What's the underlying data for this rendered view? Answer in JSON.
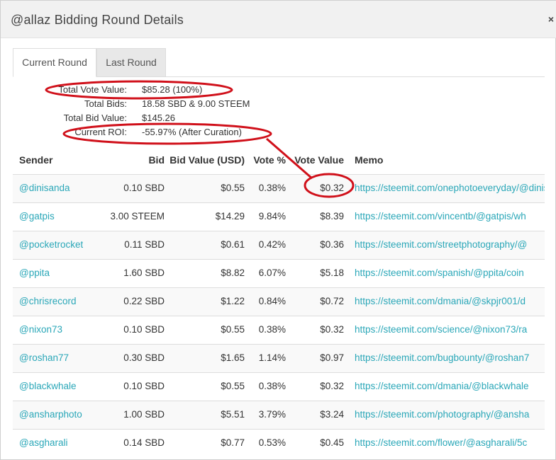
{
  "modal": {
    "title": "@allaz Bidding Round Details",
    "close": "×"
  },
  "tabs": [
    {
      "label": "Current Round",
      "active": true
    },
    {
      "label": "Last Round",
      "active": false
    }
  ],
  "summary": {
    "total_vote_value_label": "Total Vote Value:",
    "total_vote_value": "$85.28 (100%)",
    "total_bids_label": "Total Bids:",
    "total_bids": "18.58 SBD & 9.00 STEEM",
    "total_bid_value_label": "Total Bid Value:",
    "total_bid_value": "$145.26",
    "current_roi_label": "Current ROI:",
    "current_roi": "-55.97% (After Curation)"
  },
  "table": {
    "headers": [
      "Sender",
      "Bid",
      "Bid Value (USD)",
      "Vote %",
      "Vote Value",
      "Memo"
    ],
    "rows": [
      {
        "sender": "@dinisanda",
        "bid": "0.10 SBD",
        "bid_value": "$0.55",
        "vote_pct": "0.38%",
        "vote_value": "$0.32",
        "memo": "https://steemit.com/onephotoeveryday/@dinisanda"
      },
      {
        "sender": "@gatpis",
        "bid": "3.00 STEEM",
        "bid_value": "$14.29",
        "vote_pct": "9.84%",
        "vote_value": "$8.39",
        "memo": "https://steemit.com/vincentb/@gatpis/wh"
      },
      {
        "sender": "@pocketrocket",
        "bid": "0.11 SBD",
        "bid_value": "$0.61",
        "vote_pct": "0.42%",
        "vote_value": "$0.36",
        "memo": "https://steemit.com/streetphotography/@"
      },
      {
        "sender": "@ppita",
        "bid": "1.60 SBD",
        "bid_value": "$8.82",
        "vote_pct": "6.07%",
        "vote_value": "$5.18",
        "memo": "https://steemit.com/spanish/@ppita/coin"
      },
      {
        "sender": "@chrisrecord",
        "bid": "0.22 SBD",
        "bid_value": "$1.22",
        "vote_pct": "0.84%",
        "vote_value": "$0.72",
        "memo": "https://steemit.com/dmania/@skpjr001/d"
      },
      {
        "sender": "@nixon73",
        "bid": "0.10 SBD",
        "bid_value": "$0.55",
        "vote_pct": "0.38%",
        "vote_value": "$0.32",
        "memo": "https://steemit.com/science/@nixon73/ra"
      },
      {
        "sender": "@roshan77",
        "bid": "0.30 SBD",
        "bid_value": "$1.65",
        "vote_pct": "1.14%",
        "vote_value": "$0.97",
        "memo": "https://steemit.com/bugbounty/@roshan7"
      },
      {
        "sender": "@blackwhale",
        "bid": "0.10 SBD",
        "bid_value": "$0.55",
        "vote_pct": "0.38%",
        "vote_value": "$0.32",
        "memo": "https://steemit.com/dmania/@blackwhale"
      },
      {
        "sender": "@ansharphoto",
        "bid": "1.00 SBD",
        "bid_value": "$5.51",
        "vote_pct": "3.79%",
        "vote_value": "$3.24",
        "memo": "https://steemit.com/photography/@ansha"
      },
      {
        "sender": "@asgharali",
        "bid": "0.14 SBD",
        "bid_value": "$0.77",
        "vote_pct": "0.53%",
        "vote_value": "$0.45",
        "memo": "https://steemit.com/flower/@asgharali/5c"
      }
    ]
  },
  "colors": {
    "link": "#2aa7b8",
    "annotation": "#d0101a"
  }
}
